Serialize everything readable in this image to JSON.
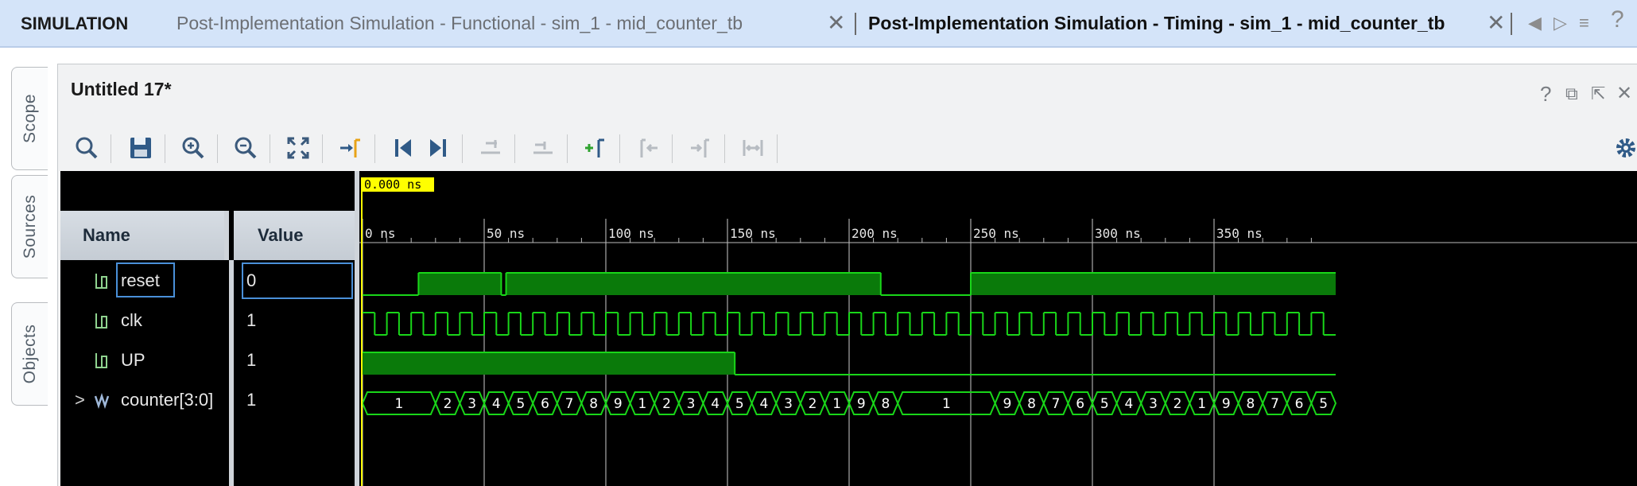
{
  "window": {
    "section_label": "SIMULATION",
    "tabs": [
      {
        "label": "Post-Implementation Simulation - Functional - sim_1 - mid_counter_tb",
        "active": false
      },
      {
        "label": "Post-Implementation Simulation - Timing - sim_1 - mid_counter_tb",
        "active": true
      }
    ],
    "close_glyph": "✕",
    "nav": {
      "prev": "◀",
      "next": "▷",
      "menu": "≡",
      "help": "?"
    }
  },
  "sidebar": {
    "tabs": [
      "Scope",
      "Sources",
      "Objects"
    ]
  },
  "panel": {
    "title": "Untitled 17*",
    "controls": {
      "help": "?",
      "restore": "⧉",
      "float": "⇱",
      "close": "✕"
    }
  },
  "toolbar": {
    "buttons": [
      {
        "name": "search-icon"
      },
      {
        "name": "save-icon"
      },
      {
        "name": "zoom-in-icon"
      },
      {
        "name": "zoom-out-icon"
      },
      {
        "name": "zoom-fit-icon"
      },
      {
        "name": "go-to-cursor-icon"
      },
      {
        "name": "go-to-time-0-icon"
      },
      {
        "name": "go-to-last-time-icon"
      },
      {
        "name": "swap-cursors-icon"
      },
      {
        "name": "cursor-to-time-icon"
      },
      {
        "name": "add-marker-icon"
      },
      {
        "name": "previous-marker-icon"
      },
      {
        "name": "next-marker-icon"
      },
      {
        "name": "fit-marker-icon"
      },
      {
        "name": "settings-gear-icon"
      }
    ]
  },
  "waveform": {
    "cursor_time": "0.000 ns",
    "columns": {
      "name": "Name",
      "value": "Value"
    },
    "signals": [
      {
        "name": "reset",
        "value": "0",
        "kind": "bit"
      },
      {
        "name": "clk",
        "value": "1",
        "kind": "bit"
      },
      {
        "name": "UP",
        "value": "1",
        "kind": "bit"
      },
      {
        "name": "counter[3:0]",
        "value": "1",
        "kind": "bus",
        "expand": ">"
      }
    ],
    "time_labels": [
      "0 ns",
      "50 ns",
      "100 ns",
      "150 ns",
      "200 ns",
      "250 ns",
      "300 ns",
      "350 ns"
    ],
    "colors": {
      "wave": "#19d619",
      "fill": "#0a7a0a",
      "cursor": "#ffff00",
      "grid": "#cccccc"
    },
    "reset_segments": [
      {
        "from": 0,
        "to": 23,
        "level": 0
      },
      {
        "from": 23,
        "to": 57,
        "level": 1
      },
      {
        "from": 57,
        "to": 59,
        "level": 0
      },
      {
        "from": 59,
        "to": 213,
        "level": 1
      },
      {
        "from": 213,
        "to": 250,
        "level": 0
      },
      {
        "from": 250,
        "to": 400,
        "level": 1
      }
    ],
    "up_segments": [
      {
        "from": 0,
        "to": 153,
        "level": 1
      },
      {
        "from": 153,
        "to": 400,
        "level": 0
      }
    ],
    "counter_segments": [
      {
        "from": 0,
        "to": 30,
        "label": "1"
      },
      {
        "from": 30,
        "to": 40,
        "label": "2"
      },
      {
        "from": 40,
        "to": 50,
        "label": "3"
      },
      {
        "from": 50,
        "to": 60,
        "label": "4"
      },
      {
        "from": 60,
        "to": 70,
        "label": "5"
      },
      {
        "from": 70,
        "to": 80,
        "label": "6"
      },
      {
        "from": 80,
        "to": 90,
        "label": "7"
      },
      {
        "from": 90,
        "to": 100,
        "label": "8"
      },
      {
        "from": 100,
        "to": 110,
        "label": "9"
      },
      {
        "from": 110,
        "to": 120,
        "label": "1"
      },
      {
        "from": 120,
        "to": 130,
        "label": "2"
      },
      {
        "from": 130,
        "to": 140,
        "label": "3"
      },
      {
        "from": 140,
        "to": 150,
        "label": "4"
      },
      {
        "from": 150,
        "to": 160,
        "label": "5"
      },
      {
        "from": 160,
        "to": 170,
        "label": "4"
      },
      {
        "from": 170,
        "to": 180,
        "label": "3"
      },
      {
        "from": 180,
        "to": 190,
        "label": "2"
      },
      {
        "from": 190,
        "to": 200,
        "label": "1"
      },
      {
        "from": 200,
        "to": 210,
        "label": "9"
      },
      {
        "from": 210,
        "to": 220,
        "label": "8"
      },
      {
        "from": 220,
        "to": 260,
        "label": "1"
      },
      {
        "from": 260,
        "to": 270,
        "label": "9"
      },
      {
        "from": 270,
        "to": 280,
        "label": "8"
      },
      {
        "from": 280,
        "to": 290,
        "label": "7"
      },
      {
        "from": 290,
        "to": 300,
        "label": "6"
      },
      {
        "from": 300,
        "to": 310,
        "label": "5"
      },
      {
        "from": 310,
        "to": 320,
        "label": "4"
      },
      {
        "from": 320,
        "to": 330,
        "label": "3"
      },
      {
        "from": 330,
        "to": 340,
        "label": "2"
      },
      {
        "from": 340,
        "to": 350,
        "label": "1"
      },
      {
        "from": 350,
        "to": 360,
        "label": "9"
      },
      {
        "from": 360,
        "to": 370,
        "label": "8"
      },
      {
        "from": 370,
        "to": 380,
        "label": "7"
      },
      {
        "from": 380,
        "to": 390,
        "label": "6"
      },
      {
        "from": 390,
        "to": 400,
        "label": "5"
      }
    ],
    "clk_period_ns": 10,
    "visible_range_ns": [
      0,
      400
    ]
  }
}
